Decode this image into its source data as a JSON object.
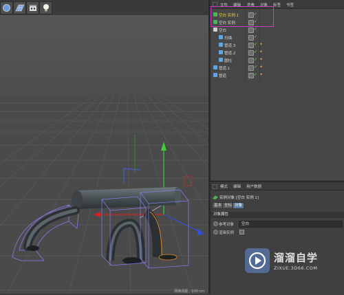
{
  "toolbar": {
    "icons": [
      "sphere-icon",
      "grid-plane-icon",
      "film-clapper-icon",
      "light-bulb-icon"
    ]
  },
  "viewport": {
    "nav_icons": "✣↕↻▢",
    "status": "网格间距 : 100 cm"
  },
  "object_manager": {
    "menu": [
      "文件",
      "编辑",
      "查看",
      "对象",
      "标签",
      "书签"
    ],
    "objects": [
      {
        "label": "空白 实例.1",
        "color": "#f0d03a",
        "icon": "instance-icon",
        "orange_tag": false
      },
      {
        "label": "空白 实例",
        "color": "#d8d8d8",
        "icon": "instance-icon",
        "orange_tag": false
      },
      {
        "label": "空白",
        "color": "#d8d8d8",
        "icon": "null-icon",
        "orange_tag": false
      },
      {
        "label": "扫描",
        "color": "#d8d8d8",
        "icon": "sweep-icon",
        "orange_tag": false
      },
      {
        "label": "管道.3",
        "color": "#d8d8d8",
        "icon": "tube-icon",
        "orange_tag": true
      },
      {
        "label": "管道.2",
        "color": "#d8d8d8",
        "icon": "tube-icon",
        "orange_tag": true
      },
      {
        "label": "圆柱",
        "color": "#d8d8d8",
        "icon": "cylinder-icon",
        "orange_tag": true
      },
      {
        "label": "管道.1",
        "color": "#d8d8d8",
        "icon": "tube-icon",
        "orange_tag": true
      },
      {
        "label": "管道",
        "color": "#d8d8d8",
        "icon": "tube-icon",
        "orange_tag": true
      }
    ]
  },
  "attribute_manager": {
    "menu": [
      "模式",
      "编辑",
      "用户数据"
    ],
    "title": "实例对象 [空白 实例.1]",
    "tabs": [
      "基本",
      "坐标",
      "对象"
    ],
    "active_tab": "对象",
    "section": "对象属性",
    "ref_label": "参考对象",
    "ref_value": "空白",
    "render_label": "渲染实例"
  },
  "watermark": {
    "text": "溜溜自学",
    "url": "ZIXUE.3D66.COM"
  },
  "colors": {
    "highlight": "#c93dc9",
    "selected_text": "#f0d03a",
    "active_tab": "#5a7ba0"
  }
}
